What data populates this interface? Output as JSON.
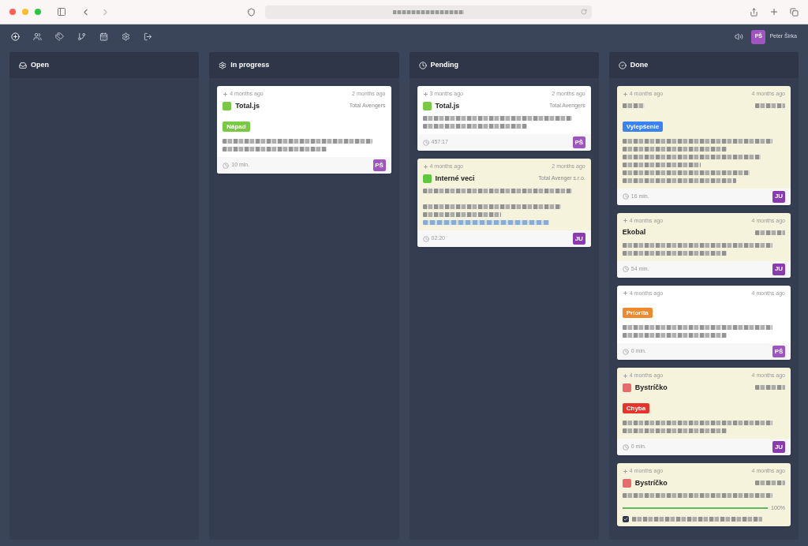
{
  "user": {
    "initials": "PŠ",
    "name": "Peter Širka",
    "color": "#9f55bf"
  },
  "columns": [
    {
      "title": "Open"
    },
    {
      "title": "In progress",
      "cards": [
        {
          "highlighted": false,
          "created": "4 months ago",
          "updated": "2 months ago",
          "project": {
            "name": "Total.js",
            "color": "#7ac943"
          },
          "client": "Total Avengers",
          "tag": {
            "label": "Nápad",
            "color": "#7ac943"
          },
          "time": "10 min.",
          "assignee": {
            "initials": "PŠ",
            "color": "#9f55bf"
          }
        }
      ]
    },
    {
      "title": "Pending",
      "cards": [
        {
          "highlighted": false,
          "created": "3 months ago",
          "updated": "2 months ago",
          "project": {
            "name": "Total.js",
            "color": "#7ac943"
          },
          "client": "Total Avengers",
          "time": "457:17",
          "assignee": {
            "initials": "PŠ",
            "color": "#9f55bf"
          }
        },
        {
          "highlighted": true,
          "created": "4 months ago",
          "updated": "2 months ago",
          "project": {
            "name": "Interné veci",
            "color": "#5ec83e"
          },
          "client": "Total Avenger s.r.o.",
          "time": "02:20",
          "assignee": {
            "initials": "JU",
            "color": "#8a3bb0"
          }
        }
      ]
    },
    {
      "title": "Done",
      "cards": [
        {
          "highlighted": true,
          "created": "4 months ago",
          "updated": "4 months ago",
          "tag": {
            "label": "Vylepšenie",
            "color": "#3b82f6"
          },
          "time": "16 min.",
          "assignee": {
            "initials": "JU",
            "color": "#8a3bb0"
          }
        },
        {
          "highlighted": true,
          "created": "4 months ago",
          "updated": "4 months ago",
          "project": {
            "name": "Ekobal"
          },
          "time": "54 min.",
          "assignee": {
            "initials": "JU",
            "color": "#8a3bb0"
          }
        },
        {
          "highlighted": false,
          "created": "4 months ago",
          "updated": "4 months ago",
          "tag": {
            "label": "Priorita",
            "color": "#f0882e"
          },
          "time": "0 min.",
          "assignee": {
            "initials": "PŠ",
            "color": "#9f55bf"
          }
        },
        {
          "highlighted": true,
          "created": "4 months ago",
          "updated": "4 months ago",
          "project": {
            "name": "Bystríčko",
            "color": "#e86a6a"
          },
          "tag": {
            "label": "Chyba",
            "color": "#e8332a"
          },
          "time": "0 min.",
          "assignee": {
            "initials": "JU",
            "color": "#8a3bb0"
          }
        },
        {
          "highlighted": true,
          "created": "4 months ago",
          "updated": "4 months ago",
          "project": {
            "name": "Bystríčko",
            "color": "#e86a6a"
          },
          "progress": {
            "level": 1,
            "reading": "100%"
          },
          "checklist": [
            {
              "checked": true
            }
          ]
        }
      ]
    }
  ]
}
